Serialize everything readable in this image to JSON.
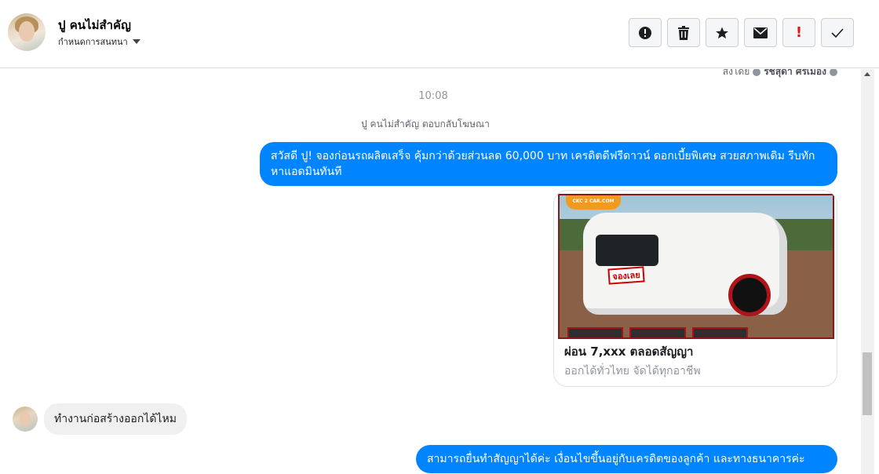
{
  "header": {
    "contact_name": "ปู คนไม่สำคัญ",
    "assign_label": "กำหนดการสนทนา",
    "toolbar": [
      {
        "icon": "alert-circle-icon"
      },
      {
        "icon": "trash-icon"
      },
      {
        "icon": "star-icon"
      },
      {
        "icon": "envelope-icon"
      },
      {
        "icon": "exclamation-icon"
      },
      {
        "icon": "check-icon"
      }
    ]
  },
  "conversation": {
    "sent_by_prefix": "ส่งโดย",
    "sent_by_name": "รชสุดา ศรีเมือง",
    "timestamp": "10:08",
    "ad_reply_notice": "ปู คนไม่สำคัญ ตอบกลับโฆษณา",
    "messages": [
      {
        "from": "page",
        "text": "สวัสดี ปู! จองก่อนรถผลิตเสร็จ คุ้มกว่าด้วยส่วนลด 60,000 บาท เครดิตดีฟรีดาวน์ ดอกเบี้ยพิเศษ สวยสภาพเดิม รีบทักหาแอดมินทันที"
      },
      {
        "from": "user",
        "text": "ทำงานก่อสร้างออกได้ไหม"
      },
      {
        "from": "page",
        "text": "สามารถยื่นทำสัญญาได้ค่ะ เงื่อนไขขึ้นอยู่กับเครดิตของลูกค้า และทางธนาคารค่ะ"
      }
    ],
    "ad_card": {
      "image_logo": "CKC 2 CAR.COM",
      "image_stamp": "จองเลย",
      "title": "ผ่อน 7,xxx ตลอดสัญญา",
      "subtitle": "ออกได้ทั่วไทย จัดได้ทุกอาชีพ"
    }
  },
  "colors": {
    "outgoing_bubble": "#0084ff",
    "incoming_bubble": "#f1f0f0",
    "alert_red": "#e0171a"
  }
}
